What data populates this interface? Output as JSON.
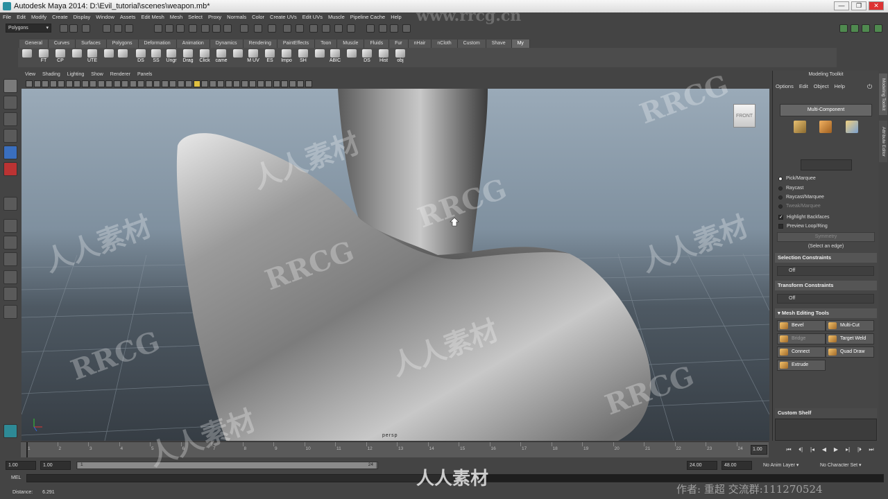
{
  "window": {
    "title": "Autodesk Maya 2014: D:\\Evil_tutorial\\scenes\\weapon.mb*",
    "minimize": "—",
    "restore": "❐",
    "close": "✕"
  },
  "menubar": [
    "File",
    "Edit",
    "Modify",
    "Create",
    "Display",
    "Window",
    "Assets",
    "Edit Mesh",
    "Mesh",
    "Select",
    "Proxy",
    "Normals",
    "Color",
    "Create UVs",
    "Edit UVs",
    "Muscle",
    "Pipeline Cache",
    "Help"
  ],
  "statusline": {
    "mode": "Polygons"
  },
  "shelf_tabs": [
    "General",
    "Curves",
    "Surfaces",
    "Polygons",
    "Deformation",
    "Animation",
    "Dynamics",
    "Rendering",
    "PaintEffects",
    "Toon",
    "Muscle",
    "Fluids",
    "Fur",
    "nHair",
    "nCloth",
    "Custom",
    "Shave",
    "My"
  ],
  "shelf_active": "My",
  "shelf_buttons": [
    "",
    "FT",
    "CP",
    "",
    "UTE",
    "",
    "",
    "DS",
    "SS",
    "Ungr",
    "Drag",
    "Click",
    "came",
    "",
    "M UV",
    "ES",
    "Impo",
    "SH",
    "",
    "ABIC",
    "",
    "DS",
    "Hist",
    "obj"
  ],
  "viewport": {
    "menu": [
      "View",
      "Shading",
      "Lighting",
      "Show",
      "Renderer",
      "Panels"
    ],
    "viewcube_label": "FRONT",
    "camera": "persp"
  },
  "modeling_toolkit": {
    "title": "Modeling Toolkit",
    "menu": [
      "Options",
      "Edit",
      "Object",
      "Help"
    ],
    "multi_component": "Multi-Component",
    "selection_modes": [
      {
        "label": "Pick/Marquee",
        "selected": true
      },
      {
        "label": "Raycast",
        "selected": false
      },
      {
        "label": "Raycast/Marquee",
        "selected": false
      },
      {
        "label": "Tweak/Marquee",
        "selected": false
      }
    ],
    "highlight_backfaces": "Highlight Backfaces",
    "preview_loop_ring": "Preview Loop/Ring",
    "symmetry": "Symmetry",
    "select_hint": "(Select an edge)",
    "selection_constraints": {
      "header": "Selection Constraints",
      "value": "Off"
    },
    "transform_constraints": {
      "header": "Transform Constraints",
      "value": "Off"
    },
    "mesh_editing_tools": {
      "header": "Mesh Editing Tools",
      "buttons": [
        "Bevel",
        "Multi-Cut",
        "Bridge",
        "Target Weld",
        "Connect",
        "Quad Draw",
        "Extrude"
      ]
    },
    "custom_shelf": "Custom Shelf"
  },
  "side_tabs": [
    "Modeling Toolkit",
    "Attribute Editor"
  ],
  "timeline": {
    "ticks": [
      "1",
      "2",
      "3",
      "4",
      "5",
      "6",
      "7",
      "8",
      "9",
      "10",
      "11",
      "12",
      "13",
      "14",
      "15",
      "16",
      "17",
      "18",
      "19",
      "20",
      "21",
      "22",
      "23",
      "24"
    ],
    "current_frame": "1.00"
  },
  "range": {
    "start": "1.00",
    "playback_start": "1.00",
    "slider_start": "1",
    "slider_end": "24",
    "playback_end": "24.00",
    "end": "48.00",
    "anim_layer": "No Anim Layer",
    "character_set": "No Character Set"
  },
  "command_line": {
    "label": "MEL"
  },
  "help_line": {
    "label": "Distance:",
    "value": "6.291"
  },
  "watermarks": {
    "brand": "RRCG",
    "url": "www.rrcg.cn",
    "cn": "人人素材",
    "author": "作者: 重超 交流群:111270524"
  }
}
